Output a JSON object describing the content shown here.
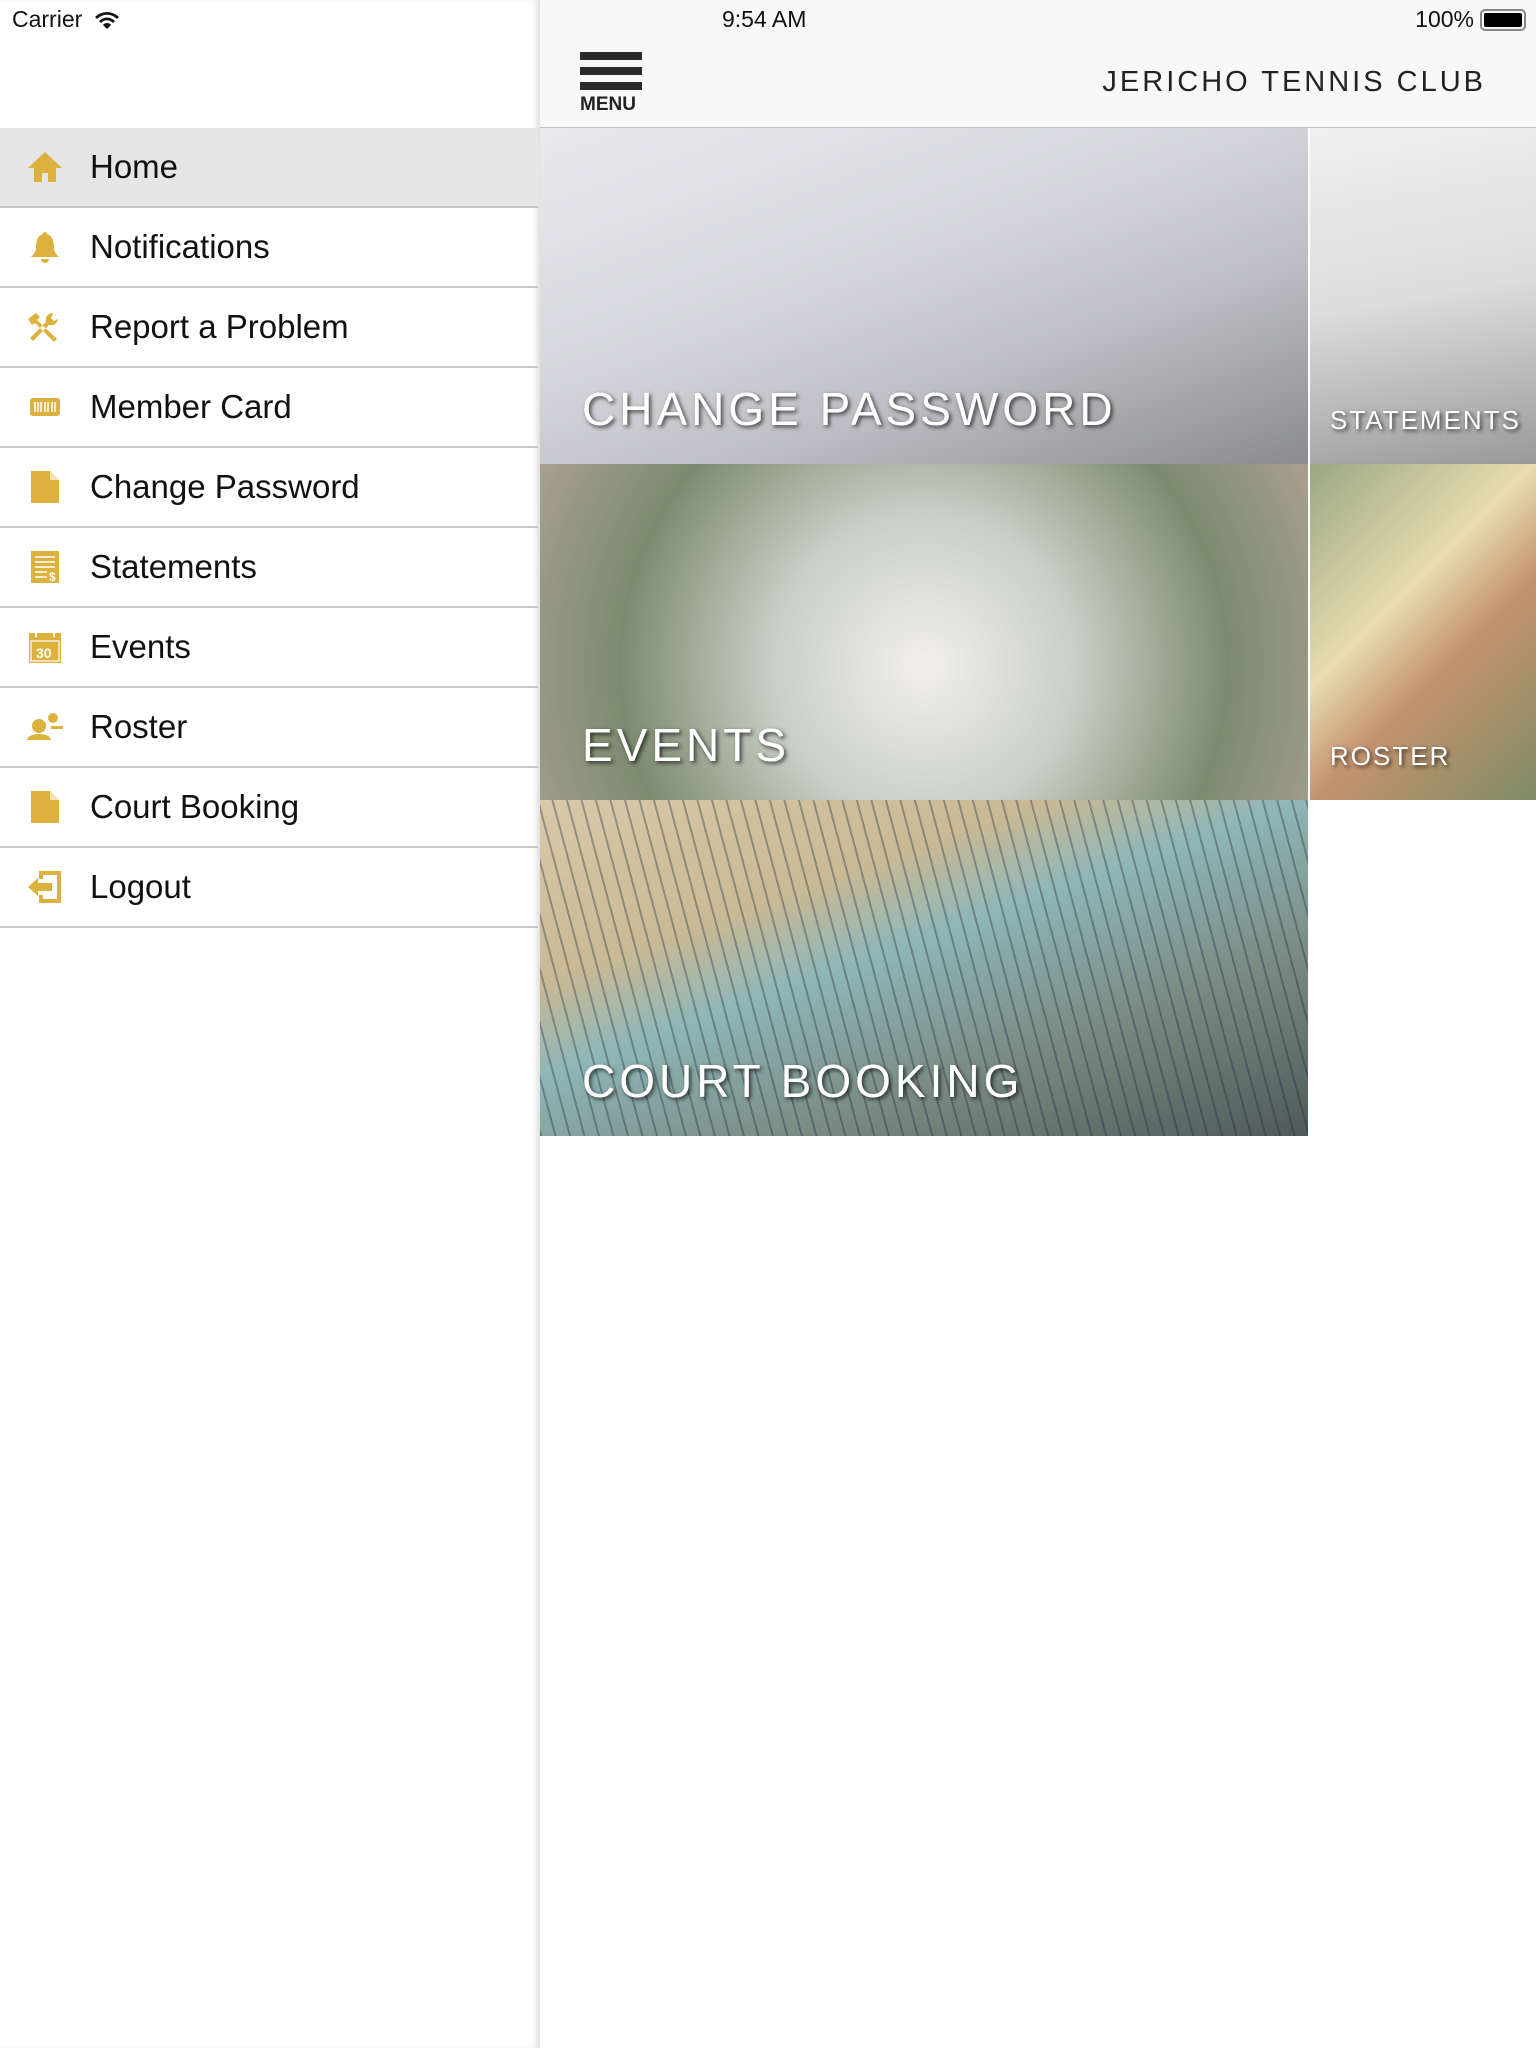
{
  "status_bar": {
    "carrier": "Carrier",
    "time": "9:54 AM",
    "battery": "100%"
  },
  "header": {
    "menu_label": "MENU",
    "title": "JERICHO TENNIS CLUB"
  },
  "accent_color": "#DDB13E",
  "sidebar": {
    "items": [
      {
        "label": "Home",
        "icon": "home-icon",
        "active": true
      },
      {
        "label": "Notifications",
        "icon": "bell-icon"
      },
      {
        "label": "Report a Problem",
        "icon": "tools-icon"
      },
      {
        "label": "Member Card",
        "icon": "barcode-card-icon"
      },
      {
        "label": "Change Password",
        "icon": "document-icon"
      },
      {
        "label": "Statements",
        "icon": "statement-icon"
      },
      {
        "label": "Events",
        "icon": "calendar-icon",
        "icon_text": "30"
      },
      {
        "label": "Roster",
        "icon": "people-icon"
      },
      {
        "label": "Court Booking",
        "icon": "document-icon"
      },
      {
        "label": "Logout",
        "icon": "logout-icon"
      }
    ]
  },
  "tiles": [
    {
      "label": "CHANGE PASSWORD"
    },
    {
      "label": "STATEMENTS"
    },
    {
      "label": "EVENTS"
    },
    {
      "label": "ROSTER"
    },
    {
      "label": "COURT BOOKING"
    }
  ]
}
